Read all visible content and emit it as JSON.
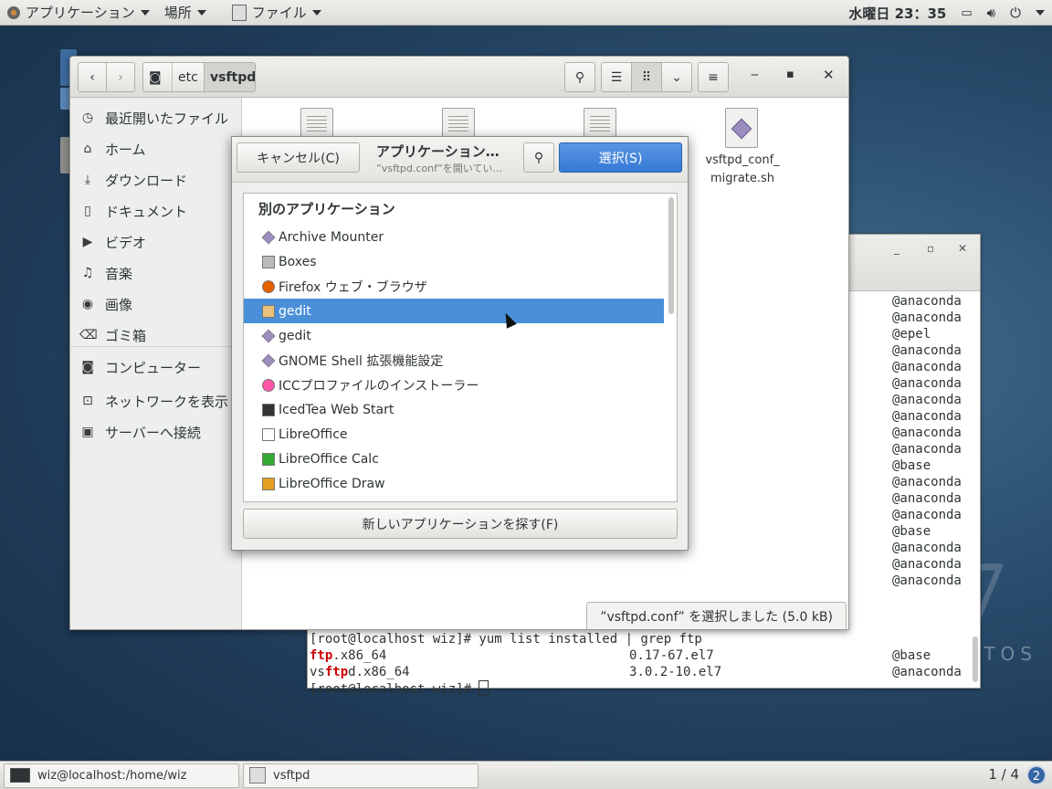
{
  "topbar": {
    "apps_label": "アプリケーション",
    "places_label": "場所",
    "files_label": "ファイル",
    "clock": "水曜日 23：35"
  },
  "nautilus": {
    "breadcrumbs": [
      "etc",
      "vsftpd"
    ],
    "sidebar": [
      {
        "icon": "clock-icon",
        "label": "最近開いたファイル"
      },
      {
        "icon": "home-icon",
        "label": "ホーム"
      },
      {
        "icon": "download-icon",
        "label": "ダウンロード"
      },
      {
        "icon": "document-icon",
        "label": "ドキュメント"
      },
      {
        "icon": "video-icon",
        "label": "ビデオ"
      },
      {
        "icon": "music-icon",
        "label": "音楽"
      },
      {
        "icon": "camera-icon",
        "label": "画像"
      },
      {
        "icon": "trash-icon",
        "label": "ゴミ箱"
      },
      {
        "icon": "computer-icon",
        "label": "コンピューター"
      },
      {
        "icon": "network-icon",
        "label": "ネットワークを表示"
      },
      {
        "icon": "server-icon",
        "label": "サーバーへ接続"
      }
    ],
    "file_label": "vsftpd_conf_\nmigrate.sh",
    "status": "”vsftpd.conf” を選択しました (5.0 kB)"
  },
  "dialog": {
    "cancel_label": "キャンセル(C)",
    "title": "アプリケーション…",
    "subtitle": "”vsftpd.conf”を開いてい…",
    "select_label": "選択(S)",
    "list_header": "別のアプリケーション",
    "apps": [
      {
        "name": "Archive Mounter",
        "icon": "archive-mounter-icon"
      },
      {
        "name": "Boxes",
        "icon": "boxes-icon"
      },
      {
        "name": "Firefox ウェブ・ブラウザ",
        "icon": "firefox-icon"
      },
      {
        "name": "gedit",
        "icon": "gedit-icon"
      },
      {
        "name": "gedit",
        "icon": "gedit-generic-icon"
      },
      {
        "name": "GNOME Shell 拡張機能設定",
        "icon": "gnome-shell-icon"
      },
      {
        "name": "ICCプロファイルのインストーラー",
        "icon": "color-profile-icon"
      },
      {
        "name": "IcedTea Web Start",
        "icon": "java-icon"
      },
      {
        "name": "LibreOffice",
        "icon": "libreoffice-icon"
      },
      {
        "name": "LibreOffice Calc",
        "icon": "calc-icon"
      },
      {
        "name": "LibreOffice Draw",
        "icon": "draw-icon"
      }
    ],
    "find_label": "新しいアプリケーションを探す(F)"
  },
  "terminal": {
    "repo_lines": [
      "@anaconda",
      "@anaconda",
      "@epel",
      "@anaconda",
      "@anaconda",
      "@anaconda",
      "@anaconda",
      "@anaconda",
      "@anaconda",
      "@anaconda",
      "@base",
      "@anaconda",
      "@anaconda",
      "@anaconda",
      "@base",
      "@anaconda",
      "@anaconda",
      "@anaconda"
    ],
    "cmd_line": "[root@localhost wiz]# yum list installed | grep ftp",
    "result1": {
      "pre": "",
      "hl": "ftp",
      "post": ".x86_64",
      "version": "0.17-67.el7",
      "repo": "@base"
    },
    "result2": {
      "pre": "vs",
      "hl": "ftp",
      "post": "d.x86_64",
      "version": "3.0.2-10.el7",
      "repo": "@anaconda"
    },
    "prompt": "[root@localhost wiz]# "
  },
  "taskbar": {
    "task1": "wiz@localhost:/home/wiz",
    "task2": "vsftpd",
    "workspace": "1 / 4",
    "badge": "2"
  },
  "desktop": {
    "brand": "TOS",
    "seven": "7"
  }
}
